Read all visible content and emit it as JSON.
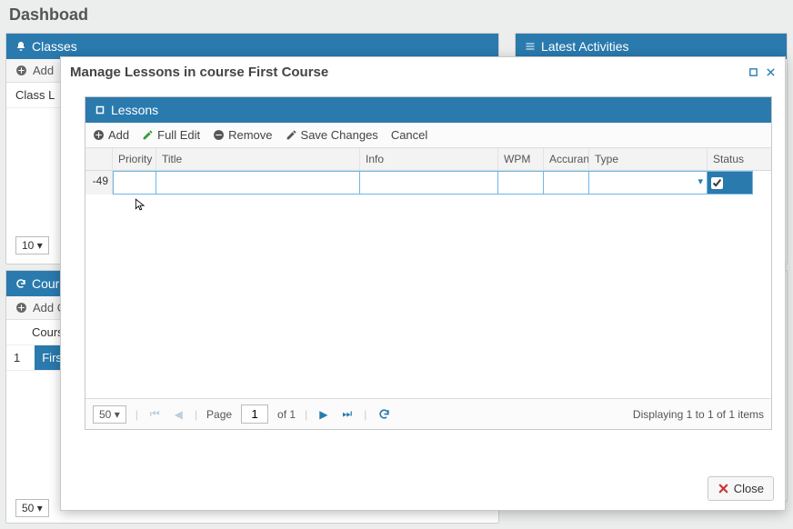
{
  "page_title": "Dashboad",
  "panels": {
    "classes": {
      "title": "Classes",
      "add": "Add",
      "list_header": "Class L"
    },
    "activities": {
      "title": "Latest Activities"
    },
    "courses": {
      "title": "Course",
      "add": "Add Co",
      "col": "Course",
      "row1_idx": "1",
      "row1_name": "First C"
    }
  },
  "page_size_top": "10",
  "page_size_bottom": "50",
  "modal": {
    "title": "Manage Lessons in course First Course",
    "sub_title": "Lessons",
    "toolbar": {
      "add": "Add",
      "full_edit": "Full Edit",
      "remove": "Remove",
      "save": "Save Changes",
      "cancel": "Cancel"
    },
    "columns": {
      "priority": "Priority",
      "title": "Title",
      "info": "Info",
      "wpm": "WPM",
      "accuracy": "Accuran",
      "type": "Type",
      "status": "Status"
    },
    "row": {
      "priority": "-49",
      "title": "",
      "info": "",
      "wpm": "",
      "accuracy": "",
      "type": "",
      "status_checked": true
    },
    "paging": {
      "size": "50",
      "page_label": "Page",
      "page": "1",
      "of_label": "of 1",
      "summary": "Displaying 1 to 1 of 1 items"
    },
    "close": "Close"
  }
}
